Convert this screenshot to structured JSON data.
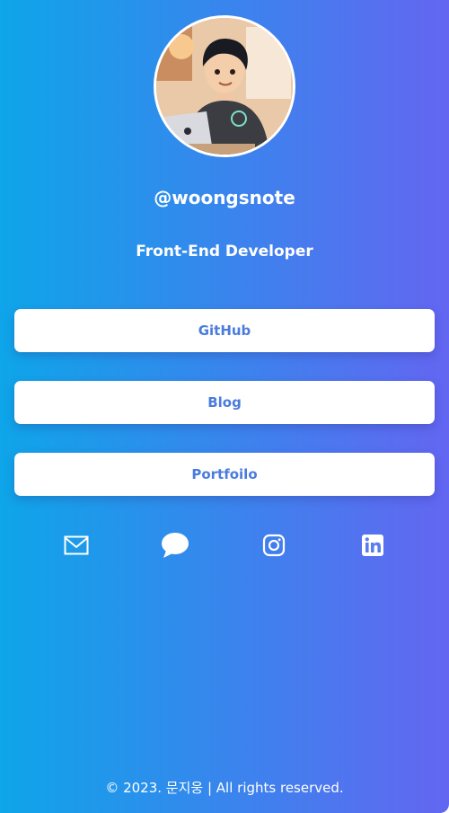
{
  "profile": {
    "handle": "@woongsnote",
    "role": "Front-End Developer",
    "avatar_alt": "avatar-illustration"
  },
  "links": [
    {
      "label": "GitHub"
    },
    {
      "label": "Blog"
    },
    {
      "label": "Portfoilo"
    }
  ],
  "social": [
    {
      "name": "mail-icon"
    },
    {
      "name": "chat-icon"
    },
    {
      "name": "instagram-icon"
    },
    {
      "name": "linkedin-icon"
    }
  ],
  "footer": {
    "text": "© 2023. 문지웅 | All rights reserved."
  },
  "colors": {
    "gradient_start": "#0ea5e9",
    "gradient_end": "#6366f1",
    "button_text": "#4a7bdf",
    "button_bg": "#ffffff"
  }
}
